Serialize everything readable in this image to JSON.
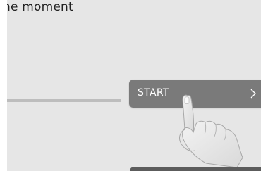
{
  "screen": {
    "heading": "ne moment",
    "start_button_label": "START"
  },
  "icons": {
    "chevron": "chevron-right-icon",
    "hand": "tap-hand-icon"
  },
  "colors": {
    "background": "#e6e6e6",
    "button": "#7a7a7a",
    "button_text": "#ffffff"
  }
}
